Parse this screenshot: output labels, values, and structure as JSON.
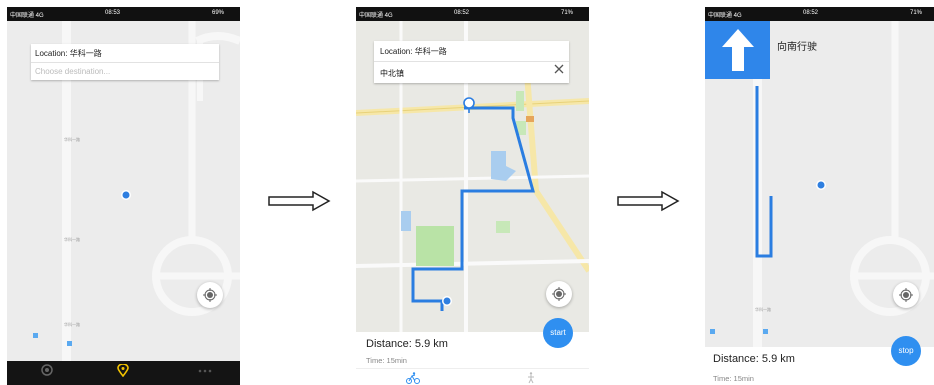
{
  "phone1": {
    "status": {
      "carrier": "中国联通 4G",
      "time": "08:53",
      "battery": "69%"
    },
    "location_label": "Location: 华科一路",
    "destination_placeholder": "Choose destination...",
    "tabs": [
      {
        "icon": "ring-icon"
      },
      {
        "icon": "pin-icon",
        "color": "#f5c400"
      },
      {
        "icon": "more-dots-icon"
      }
    ]
  },
  "phone2": {
    "status": {
      "carrier": "中国联通 4G",
      "time": "08:52",
      "battery": "71%"
    },
    "location_label": "Location: 华科一路",
    "destination_value": "中北镇",
    "distance": "Distance: 5.9 km",
    "time_text": "Time: 15min",
    "start_label": "start",
    "tabs": [
      {
        "icon": "cycling-icon",
        "color": "#2f8ff0"
      },
      {
        "icon": "walking-icon"
      }
    ]
  },
  "phone3": {
    "status": {
      "carrier": "中国联通 4G",
      "time": "08:52",
      "battery": "71%"
    },
    "direction_text": "向南行驶",
    "distance": "Distance: 5.9 km",
    "time_text": "Time: 15min",
    "stop_label": "stop"
  },
  "colors": {
    "accent": "#2f8ff0",
    "route": "#2a7de1",
    "map_bg": "#ececec"
  }
}
